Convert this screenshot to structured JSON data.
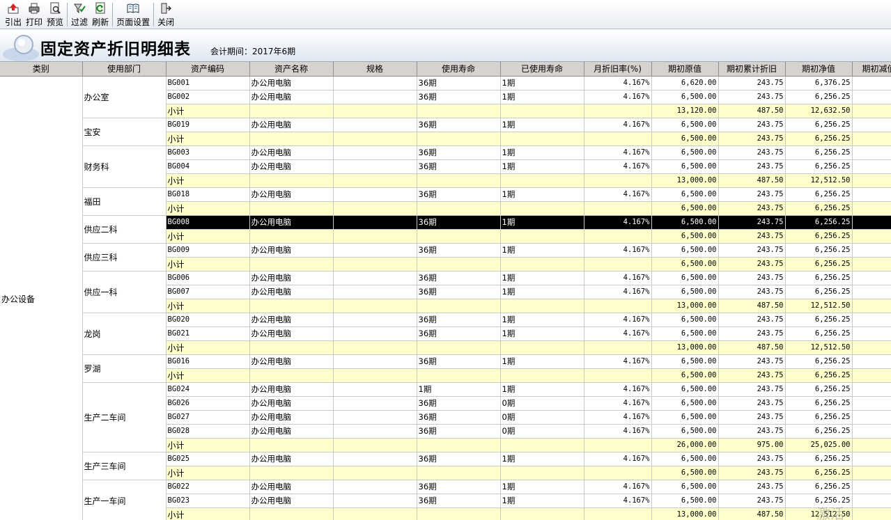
{
  "toolbar": {
    "export": "引出",
    "print": "打印",
    "preview": "预览",
    "filter": "过滤",
    "refresh": "刷新",
    "page_setup": "页面设置",
    "close": "关闭"
  },
  "header": {
    "title": "固定资产折旧明细表",
    "period": "会计期间：2017年6期"
  },
  "columns": [
    "类别",
    "使用部门",
    "资产编码",
    "资产名称",
    "规格",
    "使用寿命",
    "已使用寿命",
    "月折旧率(%)",
    "期初原值",
    "期初累计折旧",
    "期初净值",
    "期初减值"
  ],
  "category": "办公设备",
  "subtotal_label": "小计",
  "groups": [
    {
      "dept": "办公室",
      "rows": [
        [
          "BG001",
          "办公用电脑",
          "",
          "36期",
          "1期",
          "4.167%",
          "6,620.00",
          "243.75",
          "6,376.25"
        ],
        [
          "BG002",
          "办公用电脑",
          "",
          "36期",
          "1期",
          "4.167%",
          "6,500.00",
          "243.75",
          "6,256.25"
        ]
      ],
      "subtotal": [
        "13,120.00",
        "487.50",
        "12,632.50"
      ]
    },
    {
      "dept": "宝安",
      "rows": [
        [
          "BG019",
          "办公用电脑",
          "",
          "36期",
          "1期",
          "4.167%",
          "6,500.00",
          "243.75",
          "6,256.25"
        ]
      ],
      "subtotal": [
        "6,500.00",
        "243.75",
        "6,256.25"
      ]
    },
    {
      "dept": "财务科",
      "rows": [
        [
          "BG003",
          "办公用电脑",
          "",
          "36期",
          "1期",
          "4.167%",
          "6,500.00",
          "243.75",
          "6,256.25"
        ],
        [
          "BG004",
          "办公用电脑",
          "",
          "36期",
          "1期",
          "4.167%",
          "6,500.00",
          "243.75",
          "6,256.25"
        ]
      ],
      "subtotal": [
        "13,000.00",
        "487.50",
        "12,512.50"
      ]
    },
    {
      "dept": "福田",
      "rows": [
        [
          "BG018",
          "办公用电脑",
          "",
          "36期",
          "1期",
          "4.167%",
          "6,500.00",
          "243.75",
          "6,256.25"
        ]
      ],
      "subtotal": [
        "6,500.00",
        "243.75",
        "6,256.25"
      ]
    },
    {
      "dept": "供应二科",
      "selected": true,
      "rows": [
        [
          "BG008",
          "办公用电脑",
          "",
          "36期",
          "1期",
          "4.167%",
          "6,500.00",
          "243.75",
          "6,256.25"
        ]
      ],
      "subtotal": [
        "6,500.00",
        "243.75",
        "6,256.25"
      ]
    },
    {
      "dept": "供应三科",
      "rows": [
        [
          "BG009",
          "办公用电脑",
          "",
          "36期",
          "1期",
          "4.167%",
          "6,500.00",
          "243.75",
          "6,256.25"
        ]
      ],
      "subtotal": [
        "6,500.00",
        "243.75",
        "6,256.25"
      ]
    },
    {
      "dept": "供应一科",
      "rows": [
        [
          "BG006",
          "办公用电脑",
          "",
          "36期",
          "1期",
          "4.167%",
          "6,500.00",
          "243.75",
          "6,256.25"
        ],
        [
          "BG007",
          "办公用电脑",
          "",
          "36期",
          "1期",
          "4.167%",
          "6,500.00",
          "243.75",
          "6,256.25"
        ]
      ],
      "subtotal": [
        "13,000.00",
        "487.50",
        "12,512.50"
      ]
    },
    {
      "dept": "龙岗",
      "rows": [
        [
          "BG020",
          "办公用电脑",
          "",
          "36期",
          "1期",
          "4.167%",
          "6,500.00",
          "243.75",
          "6,256.25"
        ],
        [
          "BG021",
          "办公用电脑",
          "",
          "36期",
          "1期",
          "4.167%",
          "6,500.00",
          "243.75",
          "6,256.25"
        ]
      ],
      "subtotal": [
        "13,000.00",
        "487.50",
        "12,512.50"
      ]
    },
    {
      "dept": "罗湖",
      "rows": [
        [
          "BG016",
          "办公用电脑",
          "",
          "36期",
          "1期",
          "4.167%",
          "6,500.00",
          "243.75",
          "6,256.25"
        ]
      ],
      "subtotal": [
        "6,500.00",
        "243.75",
        "6,256.25"
      ]
    },
    {
      "dept": "生产二车间",
      "rows": [
        [
          "BG024",
          "办公用电脑",
          "",
          "1期",
          "1期",
          "4.167%",
          "6,500.00",
          "243.75",
          "6,256.25"
        ],
        [
          "BG026",
          "办公用电脑",
          "",
          "36期",
          "0期",
          "4.167%",
          "6,500.00",
          "243.75",
          "6,256.25"
        ],
        [
          "BG027",
          "办公用电脑",
          "",
          "36期",
          "0期",
          "4.167%",
          "6,500.00",
          "243.75",
          "6,256.25"
        ],
        [
          "BG028",
          "办公用电脑",
          "",
          "36期",
          "0期",
          "4.167%",
          "6,500.00",
          "243.75",
          "6,256.25"
        ]
      ],
      "subtotal": [
        "26,000.00",
        "975.00",
        "25,025.00"
      ]
    },
    {
      "dept": "生产三车间",
      "rows": [
        [
          "BG025",
          "办公用电脑",
          "",
          "36期",
          "1期",
          "4.167%",
          "6,500.00",
          "243.75",
          "6,256.25"
        ]
      ],
      "subtotal": [
        "6,500.00",
        "243.75",
        "6,256.25"
      ]
    },
    {
      "dept": "生产一车间",
      "rows": [
        [
          "BG022",
          "办公用电脑",
          "",
          "36期",
          "1期",
          "4.167%",
          "6,500.00",
          "243.75",
          "6,256.25"
        ],
        [
          "BG023",
          "办公用电脑",
          "",
          "36期",
          "1期",
          "4.167%",
          "6,500.00",
          "243.75",
          "6,256.25"
        ]
      ],
      "subtotal": [
        "13,000.00",
        "487.50",
        "12,512.50"
      ]
    }
  ],
  "watermark": "激活 Windows",
  "colors": {
    "subtotal_bg": "#ffffcc",
    "header_bg": "#d6d3ce",
    "selected_bg": "#000000"
  }
}
